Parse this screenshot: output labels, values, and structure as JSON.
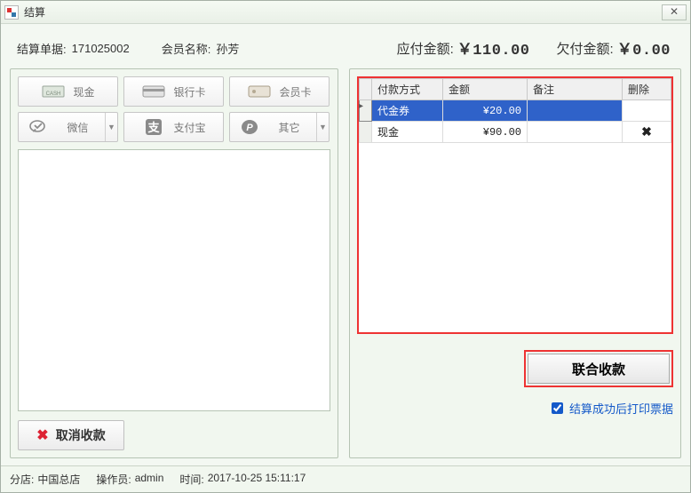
{
  "window": {
    "title": "结算"
  },
  "header": {
    "order_label": "结算单据:",
    "order_no": "171025002",
    "member_label": "会员名称:",
    "member_name": "孙芳",
    "due_label": "应付金额:",
    "due_value": "￥110.00",
    "owed_label": "欠付金额:",
    "owed_value": "￥0.00"
  },
  "pay_methods": {
    "cash": "现金",
    "bank": "银行卡",
    "member": "会员卡",
    "wechat": "微信",
    "alipay": "支付宝",
    "other": "其它"
  },
  "cancel_label": "取消收款",
  "grid": {
    "headers": {
      "method": "付款方式",
      "amount": "金额",
      "note": "备注",
      "delete": "删除"
    },
    "rows": [
      {
        "method": "代金券",
        "amount": "¥20.00",
        "note": "",
        "selected": true
      },
      {
        "method": "现金",
        "amount": "¥90.00",
        "note": "",
        "selected": false
      }
    ]
  },
  "submit_label": "联合收款",
  "print_label": "结算成功后打印票据",
  "status": {
    "branch_label": "分店:",
    "branch": "中国总店",
    "operator_label": "操作员:",
    "operator": "admin",
    "time_label": "时间:",
    "time": "2017-10-25 15:11:17"
  }
}
